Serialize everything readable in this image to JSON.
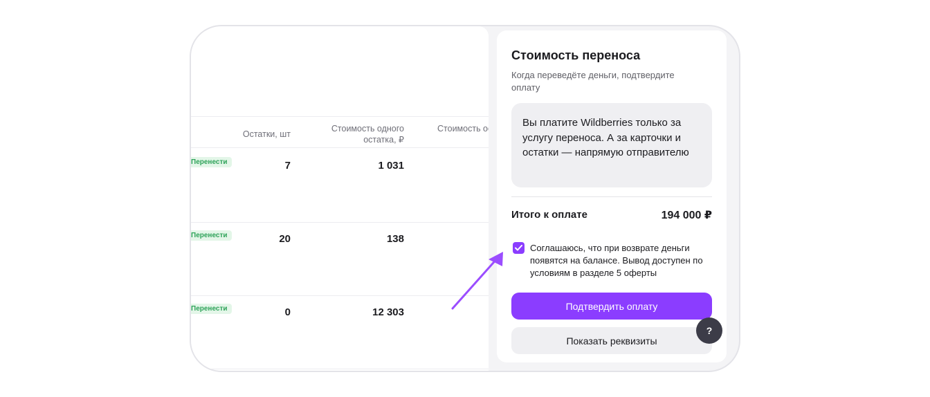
{
  "table": {
    "headers": {
      "remains": "Остатки, шт",
      "unit_cost": "Стоимость одного остатка, ₽",
      "total_cost": "Стоимость остатков"
    },
    "rows": [
      {
        "badge": "Перенести",
        "remains": "7",
        "unit_cost": "1 031"
      },
      {
        "badge": "Перенести",
        "remains": "20",
        "unit_cost": "138"
      },
      {
        "badge": "Перенести",
        "remains": "0",
        "unit_cost": "12 303"
      }
    ]
  },
  "panel": {
    "title": "Стоимость переноса",
    "subtitle": "Когда переведёте деньги, подтвердите оплату",
    "info": "Вы платите Wildberries только за услугу переноса. А за карточки и остатки — напрямую отправителю",
    "total_label": "Итого к оплате",
    "total_value": "194 000 ₽",
    "consent_checked": true,
    "consent_text": "Соглашаюсь, что при возврате деньги появятся на балансе. Вывод доступен по условиям в разделе 5 оферты",
    "confirm_label": "Подтвердить оплату",
    "details_label": "Показать реквизиты"
  },
  "help": {
    "label": "?"
  },
  "colors": {
    "accent": "#8b3dff",
    "badge_bg": "#e3f6e8",
    "badge_text": "#2fa35a",
    "arrow": "#9b4dff"
  },
  "icons": {
    "checkbox": "checkmark-icon",
    "arrow": "arrow-annotation-icon",
    "help": "question-icon"
  }
}
